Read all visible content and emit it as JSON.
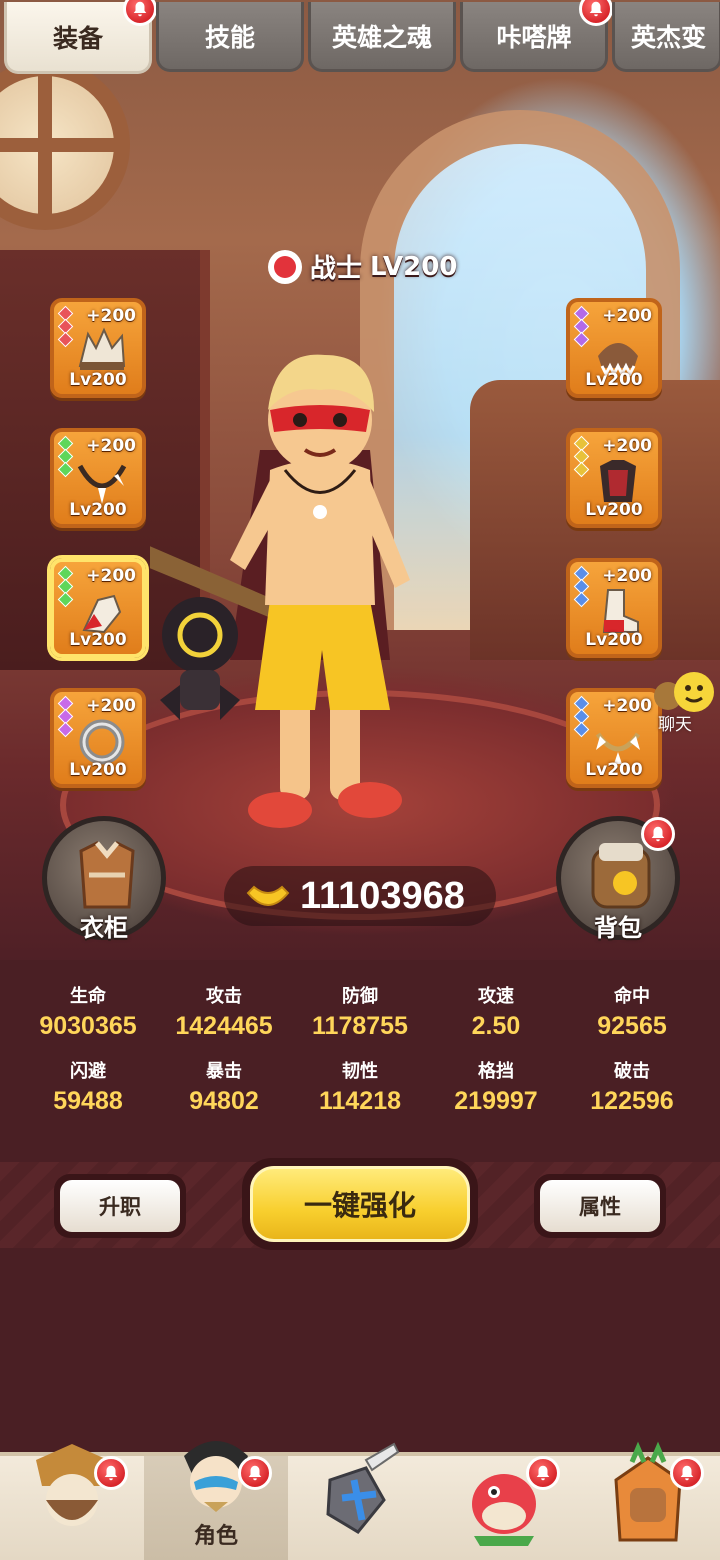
{
  "tabs": [
    {
      "label": "装备",
      "active": true,
      "badge": true
    },
    {
      "label": "技能",
      "active": false,
      "badge": false
    },
    {
      "label": "英雄之魂",
      "active": false,
      "badge": false
    },
    {
      "label": "咔嗒牌",
      "active": false,
      "badge": true
    },
    {
      "label": "英杰变",
      "active": false,
      "badge": false
    }
  ],
  "hero": {
    "class_name": "战士",
    "level": "LV200"
  },
  "equipment": {
    "left": [
      {
        "plus": "+200",
        "level": "Lv200",
        "gem_color": "#e8545a",
        "icon": "skull-crown-icon"
      },
      {
        "plus": "+200",
        "level": "Lv200",
        "gem_color": "#5ed65a",
        "icon": "fang-necklace-icon"
      },
      {
        "plus": "+200",
        "level": "Lv200",
        "gem_color": "#5ed65a",
        "icon": "bone-glove-icon"
      },
      {
        "plus": "+200",
        "level": "Lv200",
        "gem_color": "#c86ae8",
        "icon": "ring-icon"
      }
    ],
    "right": [
      {
        "plus": "+200",
        "level": "Lv200",
        "gem_color": "#b36ae8",
        "icon": "horn-helmet-icon"
      },
      {
        "plus": "+200",
        "level": "Lv200",
        "gem_color": "#e8c23a",
        "icon": "chest-armor-icon"
      },
      {
        "plus": "+200",
        "level": "Lv200",
        "gem_color": "#5a8ee8",
        "icon": "boot-icon"
      },
      {
        "plus": "+200",
        "level": "Lv200",
        "gem_color": "#5a8ee8",
        "icon": "tooth-bracelet-icon"
      }
    ]
  },
  "wardrobe": {
    "label": "衣柜"
  },
  "backpack": {
    "label": "背包"
  },
  "gold": {
    "amount": "11103968"
  },
  "chat": {
    "label": "聊天"
  },
  "stats": [
    {
      "name": "生命",
      "value": "9030365"
    },
    {
      "name": "攻击",
      "value": "1424465"
    },
    {
      "name": "防御",
      "value": "1178755"
    },
    {
      "name": "攻速",
      "value": "2.50"
    },
    {
      "name": "命中",
      "value": "92565"
    },
    {
      "name": "闪避",
      "value": "59488"
    },
    {
      "name": "暴击",
      "value": "94802"
    },
    {
      "name": "韧性",
      "value": "114218"
    },
    {
      "name": "格挡",
      "value": "219997"
    },
    {
      "name": "破击",
      "value": "122596"
    }
  ],
  "actions": {
    "promote": "升职",
    "enhance_all": "一键强化",
    "attributes": "属性"
  },
  "bottom_nav": [
    {
      "label": "",
      "icon": "caveman-icon",
      "active": false,
      "badge": true
    },
    {
      "label": "角色",
      "icon": "character-icon",
      "active": true,
      "badge": true
    },
    {
      "label": "",
      "icon": "sword-shield-icon",
      "active": false,
      "badge": false
    },
    {
      "label": "",
      "icon": "pet-dino-icon",
      "active": false,
      "badge": true
    },
    {
      "label": "",
      "icon": "tribe-icon",
      "active": false,
      "badge": true
    }
  ],
  "colors": {
    "accent_gold": "#ffd65a",
    "slot_orange": "#f6a43b",
    "badge_red": "#d8262b",
    "bg_maroon": "#4a1f24"
  }
}
